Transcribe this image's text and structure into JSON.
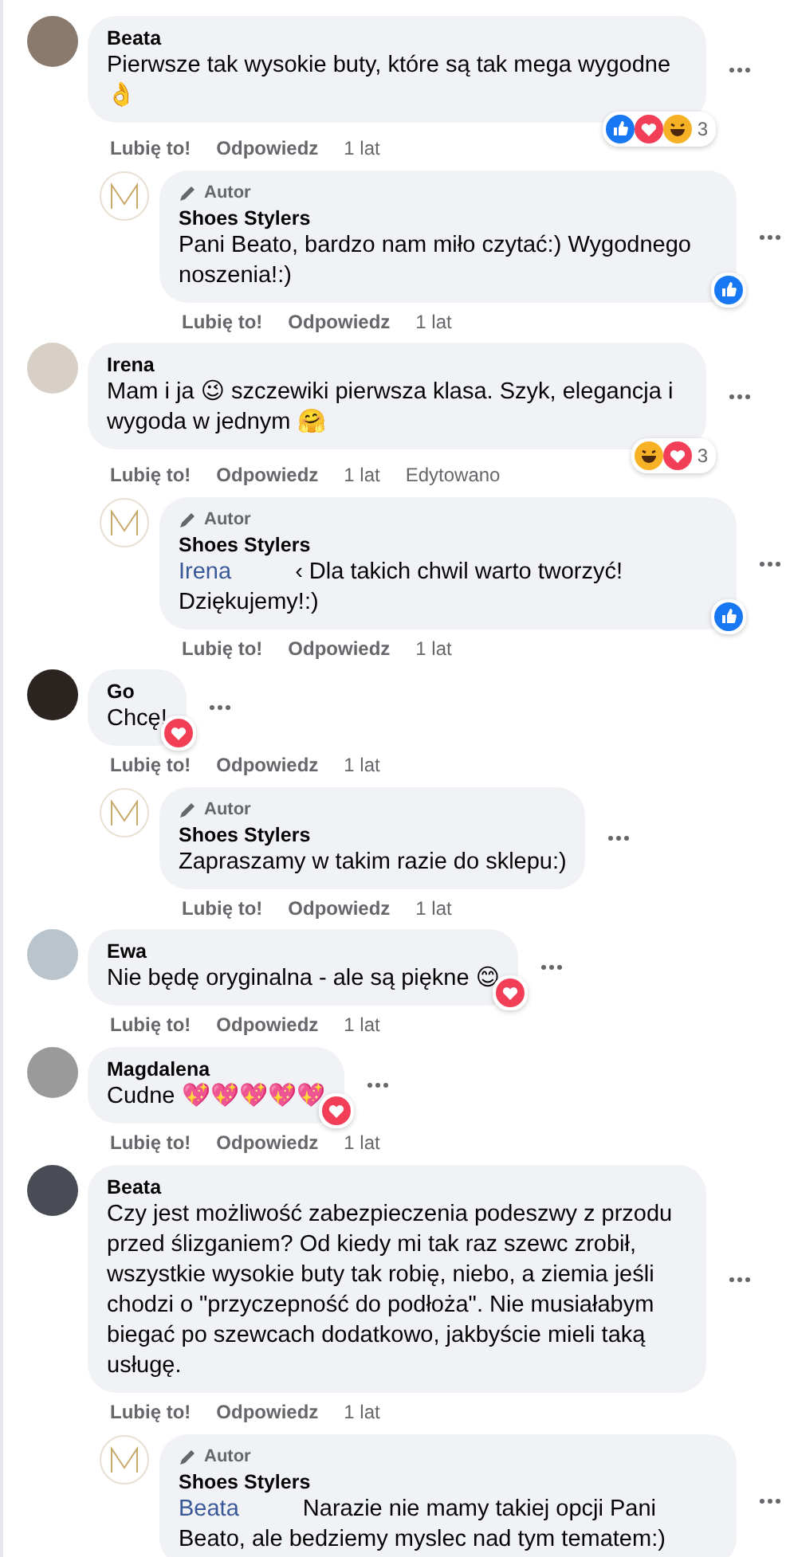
{
  "comments": [
    {
      "author": "Beata",
      "text": "Pierwsze tak wysokie buty, które są tak mega wygodne 👌",
      "actions": {
        "like": "Lubię to!",
        "reply": "Odpowiedz",
        "time": "1 lat"
      },
      "reactions": {
        "types": [
          {
            "kind": "like"
          },
          {
            "kind": "love"
          },
          {
            "kind": "haha"
          }
        ],
        "count": "3"
      },
      "replies": [
        {
          "badge": "Autor",
          "author": "Shoes Stylers",
          "text": "Pani Beato, bardzo nam miło czytać:) Wygodnego noszenia!:)",
          "actions": {
            "like": "Lubię to!",
            "reply": "Odpowiedz",
            "time": "1 lat"
          },
          "reactions": {
            "types": [
              {
                "kind": "like"
              }
            ]
          }
        }
      ]
    },
    {
      "author": "Irena",
      "text": "Mam i ja 😉 szczewiki pierwsza klasa. Szyk, elegancja i wygoda w jednym 🤗",
      "actions": {
        "like": "Lubię to!",
        "reply": "Odpowiedz",
        "time": "1 lat",
        "edited": "Edytowano"
      },
      "reactions": {
        "types": [
          {
            "kind": "haha"
          },
          {
            "kind": "love"
          }
        ],
        "count": "3"
      },
      "replies": [
        {
          "badge": "Autor",
          "author": "Shoes Stylers",
          "mention": "Irena",
          "text": "‹ Dla takich chwil warto tworzyć! Dziękujemy!:)",
          "actions": {
            "like": "Lubię to!",
            "reply": "Odpowiedz",
            "time": "1 lat"
          },
          "reactions": {
            "types": [
              {
                "kind": "like"
              }
            ]
          }
        }
      ]
    },
    {
      "author": "Go",
      "text": "Chcę!",
      "actions": {
        "like": "Lubię to!",
        "reply": "Odpowiedz",
        "time": "1 lat"
      },
      "reactions": {
        "types": [
          {
            "kind": "love"
          }
        ]
      },
      "replies": [
        {
          "badge": "Autor",
          "author": "Shoes Stylers",
          "text": "Zapraszamy w takim razie do sklepu:)",
          "actions": {
            "like": "Lubię to!",
            "reply": "Odpowiedz",
            "time": "1 lat"
          }
        }
      ]
    },
    {
      "author": "Ewa",
      "text": "Nie będę oryginalna - ale są piękne 😊",
      "actions": {
        "like": "Lubię to!",
        "reply": "Odpowiedz",
        "time": "1 lat"
      },
      "reactions": {
        "types": [
          {
            "kind": "love"
          }
        ]
      }
    },
    {
      "author": "Magdalena",
      "text": "Cudne 💖💖💖💖💖",
      "actions": {
        "like": "Lubię to!",
        "reply": "Odpowiedz",
        "time": "1 lat"
      },
      "reactions": {
        "types": [
          {
            "kind": "love"
          }
        ]
      }
    },
    {
      "author": "Beata",
      "text": "Czy jest możliwość zabezpieczenia podeszwy z przodu przed ślizganiem? Od kiedy mi tak raz szewc zrobił, wszystkie wysokie buty tak robię, niebo, a ziemia jeśli chodzi o \"przyczepność do podłoża\". Nie musiałabym biegać po szewcach dodatkowo, jakbyście mieli taką usługę.",
      "actions": {
        "like": "Lubię to!",
        "reply": "Odpowiedz",
        "time": "1 lat"
      },
      "replies": [
        {
          "badge": "Autor",
          "author": "Shoes Stylers",
          "mention": "Beata",
          "text": "Narazie nie mamy takiej opcji Pani Beato, ale bedziemy myslec nad tym tematem:)"
        }
      ]
    }
  ]
}
